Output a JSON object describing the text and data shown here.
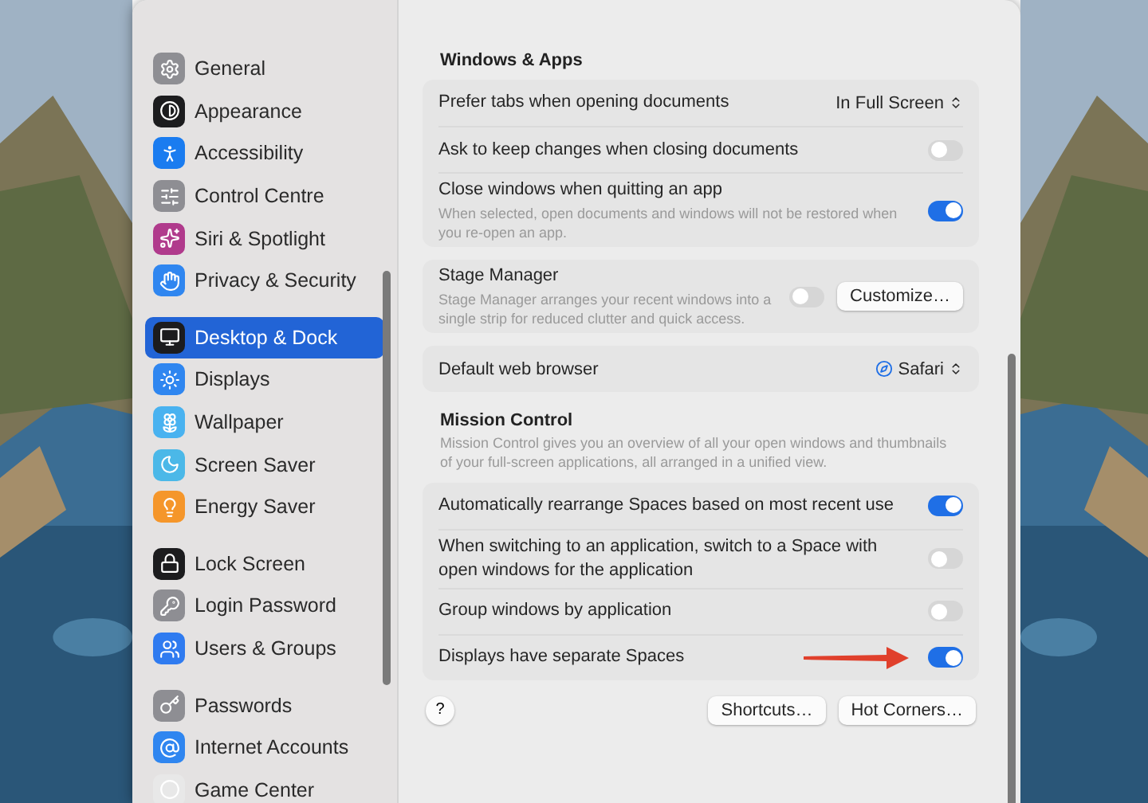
{
  "sidebar": {
    "groups": [
      {
        "items": [
          {
            "label": "General",
            "selected": false,
            "color": "#8e8e93"
          },
          {
            "label": "Appearance",
            "selected": false,
            "color": "#1c1c1e"
          },
          {
            "label": "Accessibility",
            "selected": false,
            "color": "#1a7cf0"
          },
          {
            "label": "Control Centre",
            "selected": false,
            "color": "#8e8e93"
          },
          {
            "label": "Siri & Spotlight",
            "selected": false,
            "color": "#b03a8c"
          },
          {
            "label": "Privacy & Security",
            "selected": false,
            "color": "#2f86f0"
          }
        ]
      },
      {
        "items": [
          {
            "label": "Desktop & Dock",
            "selected": true,
            "color": "#1c1c1e"
          },
          {
            "label": "Displays",
            "selected": false,
            "color": "#2f86f0"
          },
          {
            "label": "Wallpaper",
            "selected": false,
            "color": "#49b2f0"
          },
          {
            "label": "Screen Saver",
            "selected": false,
            "color": "#4bb8e8"
          },
          {
            "label": "Energy Saver",
            "selected": false,
            "color": "#f5962a"
          }
        ]
      },
      {
        "items": [
          {
            "label": "Lock Screen",
            "selected": false,
            "color": "#1c1c1e"
          },
          {
            "label": "Login Password",
            "selected": false,
            "color": "#8e8e93"
          },
          {
            "label": "Users & Groups",
            "selected": false,
            "color": "#2f7bf0"
          }
        ]
      },
      {
        "items": [
          {
            "label": "Passwords",
            "selected": false,
            "color": "#8e8e93"
          },
          {
            "label": "Internet Accounts",
            "selected": false,
            "color": "#2f86f0"
          },
          {
            "label": "Game Center",
            "selected": false,
            "color": "#e8e8e8"
          }
        ]
      }
    ]
  },
  "blocks": [
    {
      "kind": "heading",
      "title": "Windows & Apps"
    },
    {
      "kind": "card",
      "rows": [
        {
          "label": "Prefer tabs when opening documents",
          "control": {
            "kind": "popup",
            "value": "In Full Screen"
          }
        },
        {
          "label": "Ask to keep changes when closing documents",
          "control": {
            "kind": "toggle",
            "on": false
          }
        },
        {
          "label": "Close windows when quitting an app",
          "description": "When selected, open documents and windows will not be restored when you re-open an app.",
          "control": {
            "kind": "toggle",
            "on": true
          }
        }
      ]
    },
    {
      "kind": "card",
      "rows": [
        {
          "label": "Stage Manager",
          "description": "Stage Manager arranges your recent windows into a single strip for reduced clutter and quick access.",
          "control": {
            "kind": "toggle",
            "on": false
          },
          "button": "Customize…"
        }
      ]
    },
    {
      "kind": "card",
      "rows": [
        {
          "label": "Default web browser",
          "control": {
            "kind": "browser",
            "value": "Safari"
          }
        }
      ]
    },
    {
      "kind": "heading",
      "title": "Mission Control",
      "description": "Mission Control gives you an overview of all your open windows and thumbnails of your full-screen applications, all arranged in a unified view."
    },
    {
      "kind": "card",
      "rows": [
        {
          "label": "Automatically rearrange Spaces based on most recent use",
          "control": {
            "kind": "toggle",
            "on": true
          }
        },
        {
          "label": "When switching to an application, switch to a Space with open windows for the application",
          "control": {
            "kind": "toggle",
            "on": false
          }
        },
        {
          "label": "Group windows by application",
          "control": {
            "kind": "toggle",
            "on": false
          }
        },
        {
          "label": "Displays have separate Spaces",
          "control": {
            "kind": "toggle",
            "on": true
          },
          "arrow": true
        }
      ]
    }
  ],
  "footer": {
    "help": "?",
    "buttons": [
      "Shortcuts…",
      "Hot Corners…"
    ]
  }
}
